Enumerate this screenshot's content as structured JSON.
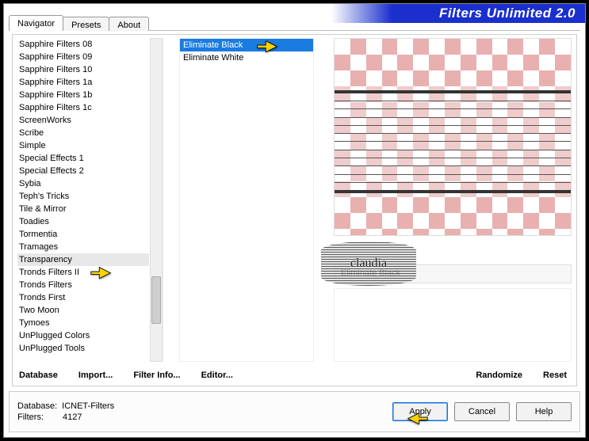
{
  "title": "Filters Unlimited 2.0",
  "tabs": {
    "navigator": "Navigator",
    "presets": "Presets",
    "about": "About"
  },
  "categories": [
    "Sapphire Filters 08",
    "Sapphire Filters 09",
    "Sapphire Filters 10",
    "Sapphire Filters 1a",
    "Sapphire Filters 1b",
    "Sapphire Filters 1c",
    "ScreenWorks",
    "Scribe",
    "Simple",
    "Special Effects 1",
    "Special Effects 2",
    "Sybia",
    "Teph's Tricks",
    "Tile & Mirror",
    "Toadies",
    "Tormentia",
    "Tramages",
    "Transparency",
    "Tronds Filters II",
    "Tronds Filters",
    "Tronds First",
    "Two Moon",
    "Tymoes",
    "UnPlugged Colors",
    "UnPlugged Tools"
  ],
  "selected_category_index": 17,
  "filters": [
    "Eliminate Black",
    "Eliminate White"
  ],
  "selected_filter_index": 0,
  "param_label": "Eliminate Black",
  "bottom_buttons": {
    "database": "Database",
    "import": "Import...",
    "filter_info": "Filter Info...",
    "editor": "Editor...",
    "randomize": "Randomize",
    "reset": "Reset"
  },
  "status": {
    "database_label": "Database:",
    "database_value": "ICNET-Filters",
    "filters_label": "Filters:",
    "filters_value": "4127"
  },
  "action_buttons": {
    "apply": "Apply",
    "cancel": "Cancel",
    "help": "Help"
  },
  "watermark": "claudia"
}
